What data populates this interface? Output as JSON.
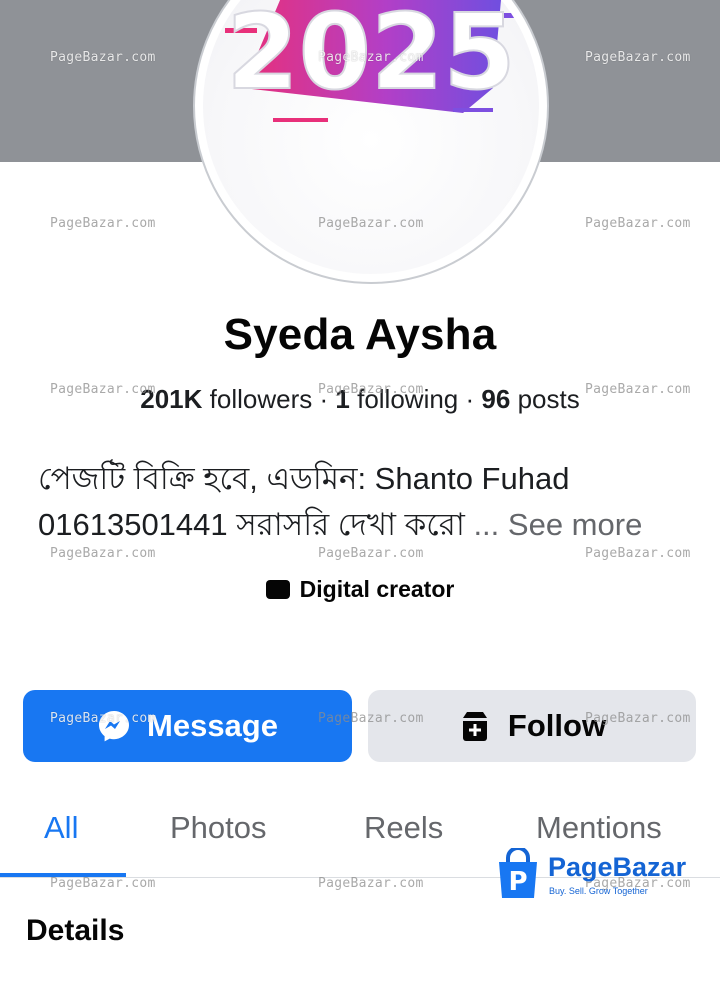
{
  "profile": {
    "avatar_text": "2025",
    "name": "Syeda Aysha",
    "stats": {
      "followers_count": "201K",
      "followers_label": "followers",
      "sep1": "·",
      "following_count": "1",
      "following_label": "following",
      "sep2": "·",
      "posts_count": "96",
      "posts_label": "posts"
    },
    "bio": {
      "line1": "পেজটি বিক্রি হবে, এডমিন: Shanto Fuhad",
      "line2": "01613501441 সরাসরি দেখা করো",
      "ellipsis": "...",
      "see_more": "See more"
    },
    "category": "Digital creator"
  },
  "actions": {
    "message_label": "Message",
    "follow_label": "Follow"
  },
  "tabs": [
    {
      "label": "All",
      "active": true
    },
    {
      "label": "Photos",
      "active": false
    },
    {
      "label": "Reels",
      "active": false
    },
    {
      "label": "Mentions",
      "active": false
    }
  ],
  "section_title": "Details",
  "watermark": {
    "text": "PageBazar.com",
    "logo_name": "PageBazar",
    "logo_tagline": "Buy. Sell. Grow Together"
  },
  "colors": {
    "accent": "#1877f2",
    "cover": "#8f9297",
    "secondary_button": "#e4e6eb",
    "muted_text": "#65676b"
  },
  "icons": {
    "message_button": "messenger-icon",
    "follow_button": "follow-icon",
    "category": "video-icon",
    "logo": "shopping-bag-icon"
  }
}
